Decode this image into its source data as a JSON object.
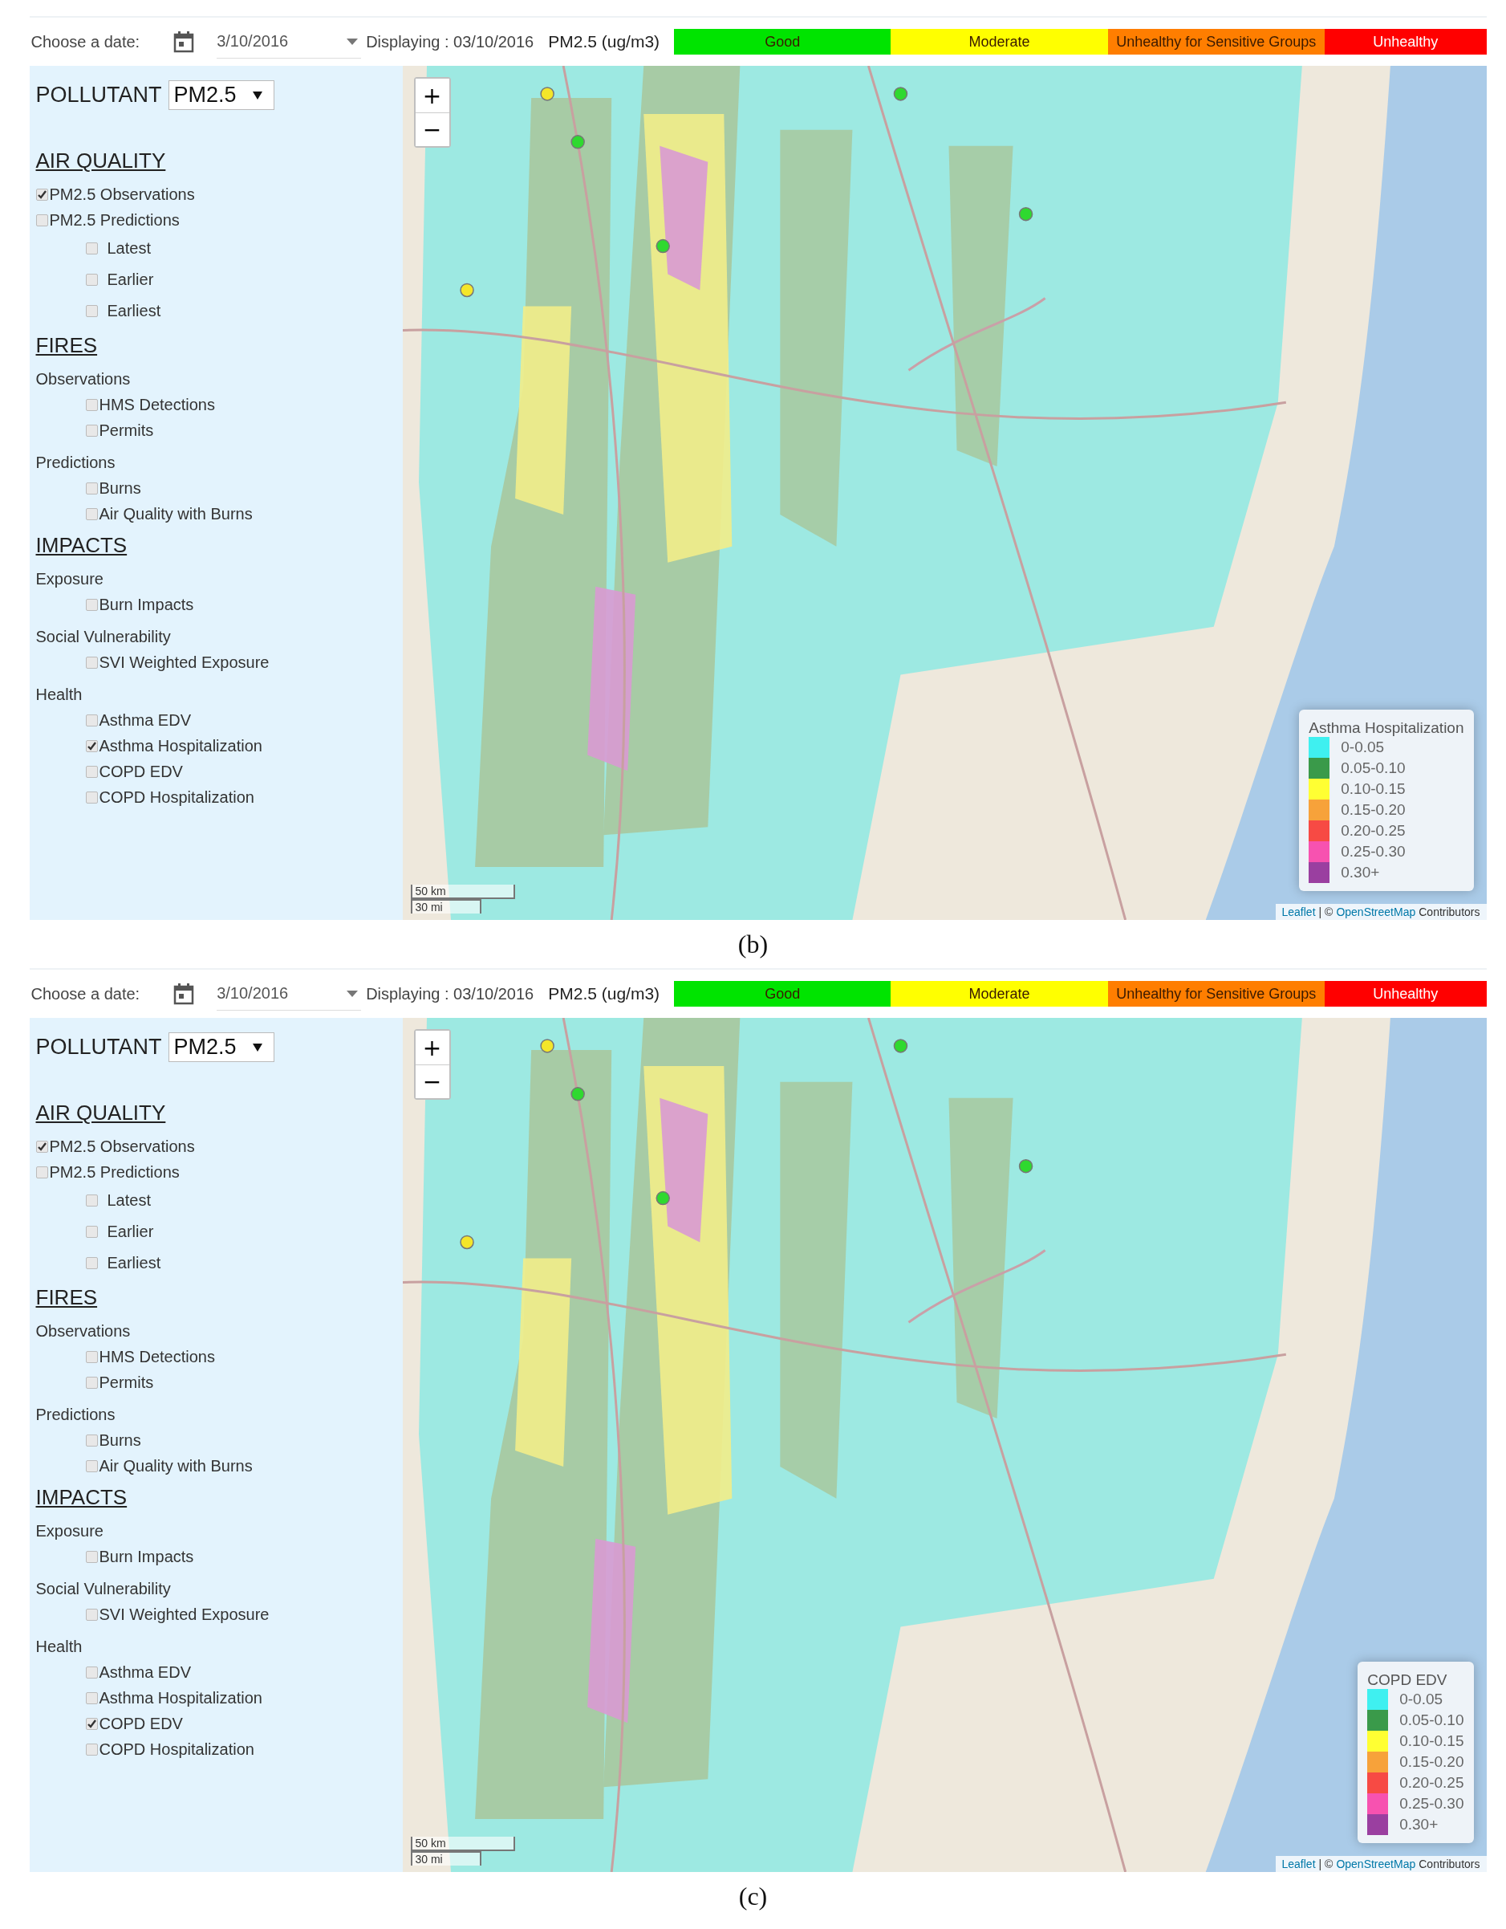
{
  "figures": [
    {
      "caption": "(b)",
      "toolbar": {
        "date_label": "Choose a date:",
        "date_value": "3/10/2016",
        "displaying": "Displaying : 03/10/2016",
        "unit": "PM2.5 (ug/m3)",
        "categories": [
          {
            "label": "Good",
            "color": "#00e400"
          },
          {
            "label": "Moderate",
            "color": "#ffff00"
          },
          {
            "label": "Unhealthy for Sensitive Groups",
            "color": "#ff7e00"
          },
          {
            "label": "Unhealthy",
            "color": "#ff0000"
          }
        ]
      },
      "pollutant": {
        "label": "POLLUTANT",
        "value": "PM2.5"
      },
      "sections": [
        {
          "title": "AIR QUALITY",
          "items": [
            {
              "kind": "checkbox",
              "label": "PM2.5 Observations",
              "checked": true
            },
            {
              "kind": "checkbox",
              "label": "PM2.5 Predictions",
              "checked": false,
              "children": [
                {
                  "label": "Latest",
                  "checked": false
                },
                {
                  "label": "Earlier",
                  "checked": false
                },
                {
                  "label": "Earliest",
                  "checked": false
                }
              ]
            }
          ]
        },
        {
          "title": "FIRES",
          "items": [
            {
              "kind": "group",
              "label": "Observations",
              "children": [
                {
                  "label": "HMS Detections",
                  "checked": false
                },
                {
                  "label": "Permits",
                  "checked": false
                }
              ]
            },
            {
              "kind": "group",
              "label": "Predictions",
              "children": [
                {
                  "label": "Burns",
                  "checked": false
                },
                {
                  "label": "Air Quality with Burns",
                  "checked": false
                }
              ]
            }
          ]
        },
        {
          "title": "IMPACTS",
          "items": [
            {
              "kind": "group",
              "label": "Exposure",
              "children": [
                {
                  "label": "Burn Impacts",
                  "checked": false
                }
              ]
            },
            {
              "kind": "group",
              "label": "Social Vulnerability",
              "children": [
                {
                  "label": "SVI Weighted Exposure",
                  "checked": false
                }
              ]
            },
            {
              "kind": "group",
              "label": "Health",
              "children": [
                {
                  "label": "Asthma EDV",
                  "checked": false
                },
                {
                  "label": "Asthma Hospitalization",
                  "checked": true
                },
                {
                  "label": "COPD EDV",
                  "checked": false
                },
                {
                  "label": "COPD Hospitalization",
                  "checked": false
                }
              ]
            }
          ]
        }
      ],
      "map": {
        "zoom_in": "+",
        "zoom_out": "−",
        "scale": [
          "50 km",
          "30 mi"
        ],
        "attribution": {
          "leaflet": "Leaflet",
          "separator": "| ©",
          "osm": "OpenStreetMap",
          "contributors": "Contributors"
        },
        "legend": {
          "title": "Asthma Hospitalization",
          "items": [
            {
              "label": "0-0.05",
              "color": "#3ff0f0"
            },
            {
              "label": "0.05-0.10",
              "color": "#3a9a4a"
            },
            {
              "label": "0.10-0.15",
              "color": "#ffff33"
            },
            {
              "label": "0.15-0.20",
              "color": "#f7a23a"
            },
            {
              "label": "0.20-0.25",
              "color": "#f74a44"
            },
            {
              "label": "0.25-0.30",
              "color": "#f752b0"
            },
            {
              "label": "0.30+",
              "color": "#9a3fa0"
            }
          ]
        }
      }
    },
    {
      "caption": "(c)",
      "toolbar": {
        "date_label": "Choose a date:",
        "date_value": "3/10/2016",
        "displaying": "Displaying : 03/10/2016",
        "unit": "PM2.5 (ug/m3)",
        "categories": [
          {
            "label": "Good",
            "color": "#00e400"
          },
          {
            "label": "Moderate",
            "color": "#ffff00"
          },
          {
            "label": "Unhealthy for Sensitive Groups",
            "color": "#ff7e00"
          },
          {
            "label": "Unhealthy",
            "color": "#ff0000"
          }
        ]
      },
      "pollutant": {
        "label": "POLLUTANT",
        "value": "PM2.5"
      },
      "sections": [
        {
          "title": "AIR QUALITY",
          "items": [
            {
              "kind": "checkbox",
              "label": "PM2.5 Observations",
              "checked": true
            },
            {
              "kind": "checkbox",
              "label": "PM2.5 Predictions",
              "checked": false,
              "children": [
                {
                  "label": "Latest",
                  "checked": false
                },
                {
                  "label": "Earlier",
                  "checked": false
                },
                {
                  "label": "Earliest",
                  "checked": false
                }
              ]
            }
          ]
        },
        {
          "title": "FIRES",
          "items": [
            {
              "kind": "group",
              "label": "Observations",
              "children": [
                {
                  "label": "HMS Detections",
                  "checked": false
                },
                {
                  "label": "Permits",
                  "checked": false
                }
              ]
            },
            {
              "kind": "group",
              "label": "Predictions",
              "children": [
                {
                  "label": "Burns",
                  "checked": false
                },
                {
                  "label": "Air Quality with Burns",
                  "checked": false
                }
              ]
            }
          ]
        },
        {
          "title": "IMPACTS",
          "items": [
            {
              "kind": "group",
              "label": "Exposure",
              "children": [
                {
                  "label": "Burn Impacts",
                  "checked": false
                }
              ]
            },
            {
              "kind": "group",
              "label": "Social Vulnerability",
              "children": [
                {
                  "label": "SVI Weighted Exposure",
                  "checked": false
                }
              ]
            },
            {
              "kind": "group",
              "label": "Health",
              "children": [
                {
                  "label": "Asthma EDV",
                  "checked": false
                },
                {
                  "label": "Asthma Hospitalization",
                  "checked": false
                },
                {
                  "label": "COPD EDV",
                  "checked": true
                },
                {
                  "label": "COPD Hospitalization",
                  "checked": false
                }
              ]
            }
          ]
        }
      ],
      "map": {
        "zoom_in": "+",
        "zoom_out": "−",
        "scale": [
          "50 km",
          "30 mi"
        ],
        "attribution": {
          "leaflet": "Leaflet",
          "separator": "| ©",
          "osm": "OpenStreetMap",
          "contributors": "Contributors"
        },
        "legend": {
          "title": "COPD EDV",
          "items": [
            {
              "label": "0-0.05",
              "color": "#3ff0f0"
            },
            {
              "label": "0.05-0.10",
              "color": "#3a9a4a"
            },
            {
              "label": "0.10-0.15",
              "color": "#ffff33"
            },
            {
              "label": "0.15-0.20",
              "color": "#f7a23a"
            },
            {
              "label": "0.20-0.25",
              "color": "#f74a44"
            },
            {
              "label": "0.25-0.30",
              "color": "#f752b0"
            },
            {
              "label": "0.30+",
              "color": "#9a3fa0"
            }
          ]
        }
      }
    }
  ]
}
